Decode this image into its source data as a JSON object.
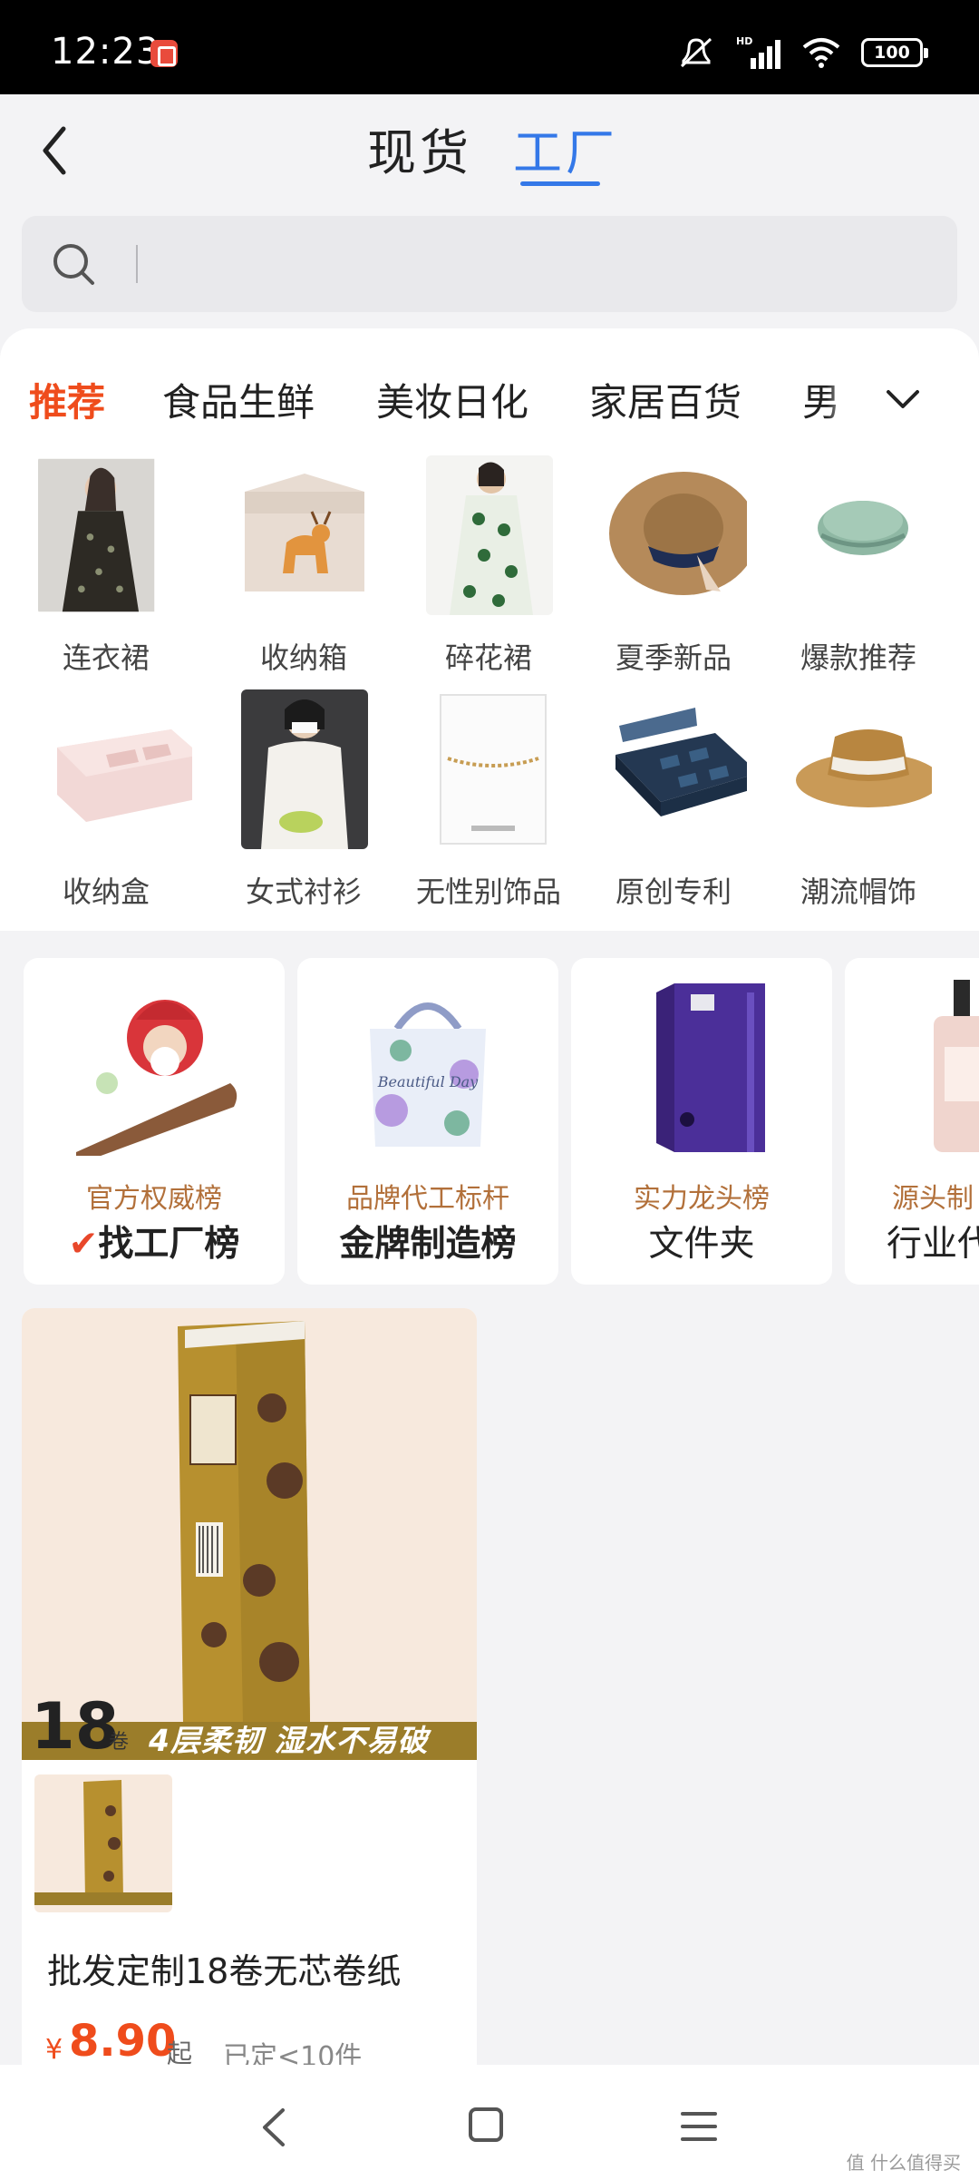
{
  "status_bar": {
    "time": "12:23",
    "network": "HD",
    "battery": "100"
  },
  "header": {
    "tabs": [
      {
        "label": "现货",
        "active": false
      },
      {
        "label": "工厂",
        "active": true
      }
    ]
  },
  "search": {
    "placeholder": ""
  },
  "categories": {
    "tabs": [
      "推荐",
      "食品生鲜",
      "美妆日化",
      "家居百货",
      "男"
    ],
    "active_index": 0,
    "active_color": "#ef4c1c"
  },
  "grid_items": [
    {
      "label": "连衣裙",
      "icon": "floral-dress-photo"
    },
    {
      "label": "收纳箱",
      "icon": "deer-storage-box"
    },
    {
      "label": "碎花裙",
      "icon": "green-floral-dress"
    },
    {
      "label": "夏季新品",
      "icon": "straw-hat"
    },
    {
      "label": "爆款推荐",
      "icon": "green-beret"
    },
    {
      "label": "收纳盒",
      "icon": "pink-organizer"
    },
    {
      "label": "女式衬衫",
      "icon": "white-blouse"
    },
    {
      "label": "无性别饰品",
      "icon": "bracelet-card"
    },
    {
      "label": "原创专利",
      "icon": "pill-box"
    },
    {
      "label": "潮流帽饰",
      "icon": "panama-hat"
    }
  ],
  "rank_cards": [
    {
      "subtitle": "官方权威榜",
      "title": "找工厂榜",
      "icon": "santa-figure"
    },
    {
      "subtitle": "品牌代工标杆",
      "title": "金牌制造榜",
      "icon": "gift-bag"
    },
    {
      "subtitle": "实力龙头榜",
      "title": "文件夹",
      "icon": "purple-binder"
    },
    {
      "subtitle": "源头制",
      "title": "行业代",
      "icon": "lotion-bottle"
    }
  ],
  "product": {
    "hero_count": "18",
    "hero_unit": "卷",
    "hero_banner": "4层柔韧 湿水不易破",
    "title": "批发定制18卷无芯卷纸",
    "price_symbol": "¥",
    "price": "8.90",
    "price_suffix": "起",
    "sold": "已定<10件"
  },
  "watermark": "值 什么值得买"
}
